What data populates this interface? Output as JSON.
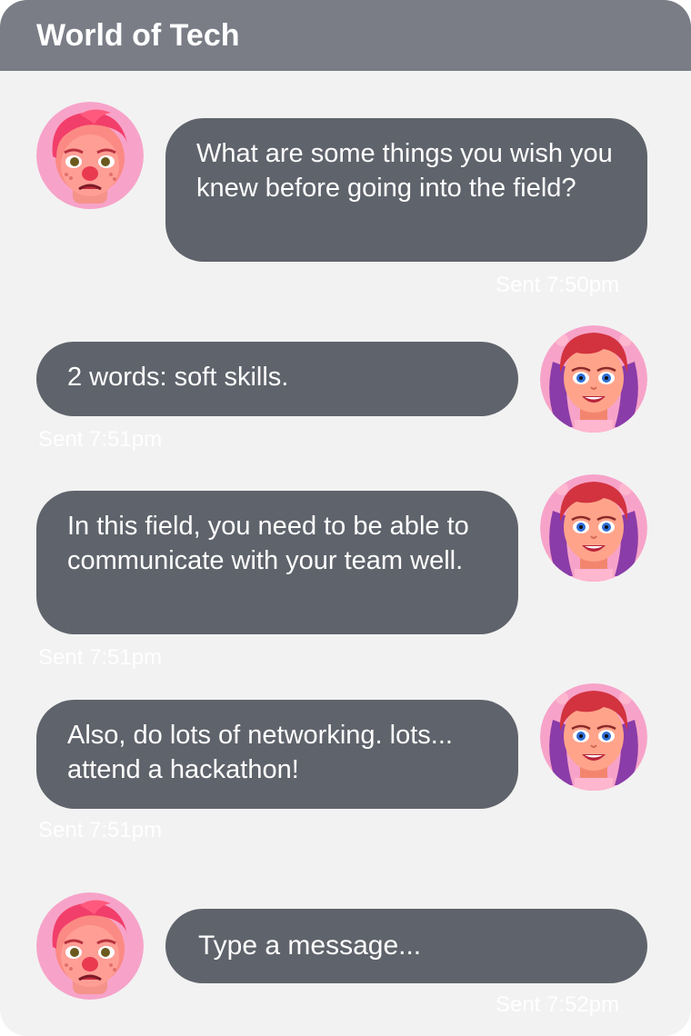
{
  "header": {
    "title": "World of Tech"
  },
  "messages": [
    {
      "text": "What are some things you wish you knew before going into the field?",
      "timestamp": "Sent 7:50pm"
    },
    {
      "text": "2 words: soft skills.",
      "timestamp": "Sent 7:51pm"
    },
    {
      "text": "In this field, you need to be able to communicate with your team well.",
      "timestamp": "Sent 7:51pm"
    },
    {
      "text": "Also, do lots of networking. lots... attend a hackathon!",
      "timestamp": "Sent 7:51pm"
    }
  ],
  "composer": {
    "placeholder": "Type a message...",
    "timestamp": "Sent 7:52pm"
  },
  "avatars": {
    "boy": "boy-avatar",
    "girl": "girl-avatar"
  }
}
